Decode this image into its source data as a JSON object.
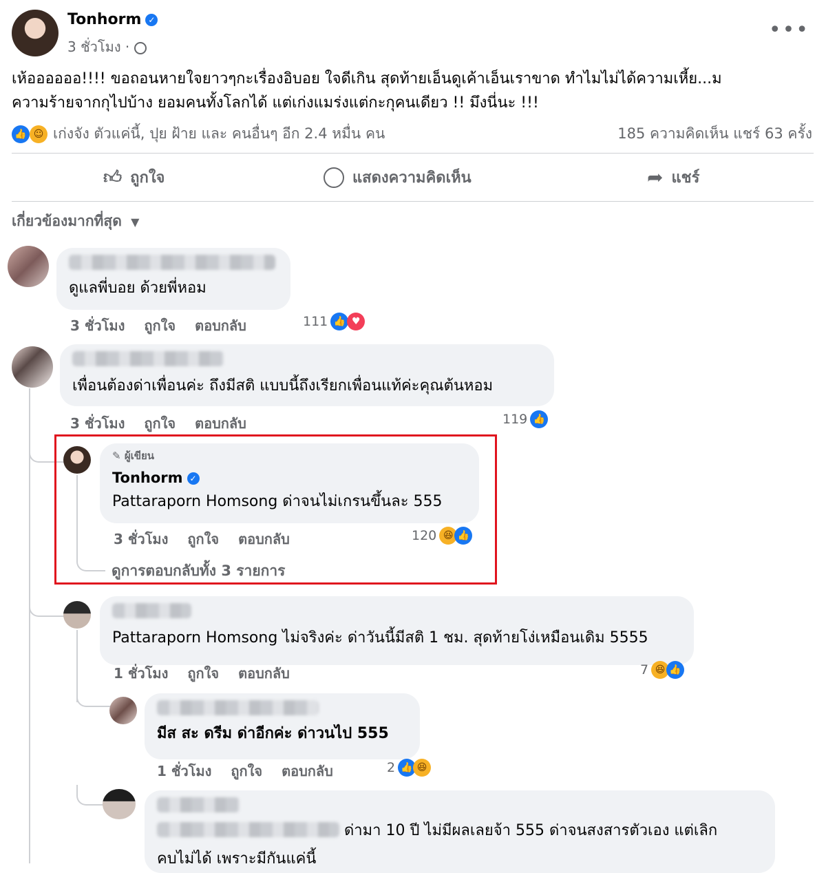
{
  "post": {
    "author": "Tonhorm",
    "time": "3 ชั่วโมง ·",
    "text_line1": "เห้ออออออ!!!! ขอถอนหายใจยาวๆกะเรื่องอิบอย ใจดีเกิน สุดท้ายเอ็นดูเค้าเอ็นเราขาด ทำไมไม่ได้ความเหี้ย...ม",
    "text_line2": "ความร้ายจากกุไปบ้าง ยอมคนทั้งโลกได้ แต่เก่งแมร่งแต่กะกุคนเดียว !! มึงนี่นะ !!!",
    "reactions_text": "เก่งจัง ตัวแค่นี้, ปุย ฝ้าย และ คนอื่นๆ อีก 2.4 หมื่น คน",
    "stats_text": "185 ความคิดเห็น   แชร์ 63 ครั้ง"
  },
  "actions": {
    "like": "ถูกใจ",
    "comment": "แสดงความคิดเห็น",
    "share": "แชร์"
  },
  "sort_label": "เกี่ยวข้องมากที่สุด",
  "comments": [
    {
      "text": "ดูแลพี่บอย ด้วยพี่หอม",
      "time": "3 ชั่วโมง",
      "like": "ถูกใจ",
      "reply": "ตอบกลับ",
      "count": "111"
    },
    {
      "text": "เพื่อนต้องด่าเพื่อนค่ะ ถึงมีสติ แบบนี้ถึงเรียกเพื่อนแท้ค่ะคุณต้นหอม",
      "time": "3 ชั่วโมง",
      "like": "ถูกใจ",
      "reply": "ตอบกลับ",
      "count": "119"
    }
  ],
  "author_reply": {
    "badge": "ผู้เขียน",
    "name": "Tonhorm",
    "text": "Pattaraporn Homsong ด่าจนไม่เกรนขึ้นละ 555",
    "time": "3 ชั่วโมง",
    "like": "ถูกใจ",
    "reply": "ตอบกลับ",
    "count": "120",
    "view_replies": "ดูการตอบกลับทั้ง 3 รายการ"
  },
  "replies": [
    {
      "text": "Pattaraporn Homsong ไม่จริงค่ะ ด่าวันนี้มีสติ 1 ชม. สุดท้ายโง่เหมือนเดิม 5555",
      "time": "1 ชั่วโมง",
      "like": "ถูกใจ",
      "reply": "ตอบกลับ",
      "count": "7"
    },
    {
      "text": "มีส สะ ดรีม ด่าอีกค่ะ ด่าวนไป 555",
      "time": "1 ชั่วโมง",
      "like": "ถูกใจ",
      "reply": "ตอบกลับ",
      "count": "2"
    },
    {
      "text_line1": "ด่ามา 10 ปี ไม่มีผลเลยจ้า 555 ด่าจนสงสารตัวเอง แต่เลิก",
      "text_line2": "คบไม่ได้ เพราะมีกันแค่นี้"
    }
  ]
}
